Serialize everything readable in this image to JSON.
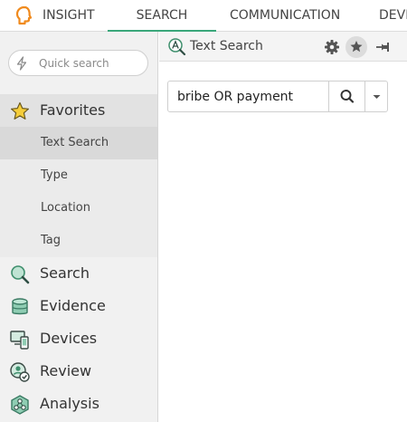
{
  "topnav": {
    "tabs": [
      {
        "label": "INSIGHT",
        "icon": "insight-head-icon"
      },
      {
        "label": "SEARCH",
        "active": true
      },
      {
        "label": "COMMUNICATION"
      },
      {
        "label": "DEVI"
      }
    ],
    "accent_color": "#3aa77a",
    "logo_color": "#f08a1d"
  },
  "sidebar": {
    "quick_search": {
      "placeholder": "Quick search",
      "value": "",
      "icon": "bolt-icon"
    },
    "favorites": {
      "label": "Favorites",
      "icon": "star-icon",
      "items": [
        {
          "label": "Text Search",
          "active": true
        },
        {
          "label": "Type"
        },
        {
          "label": "Location"
        },
        {
          "label": "Tag"
        }
      ]
    },
    "sections": [
      {
        "label": "Search",
        "icon": "magnifier-icon"
      },
      {
        "label": "Evidence",
        "icon": "database-icon"
      },
      {
        "label": "Devices",
        "icon": "devices-icon"
      },
      {
        "label": "Review",
        "icon": "review-icon"
      },
      {
        "label": "Analysis",
        "icon": "analysis-icon"
      }
    ]
  },
  "panel": {
    "title": "Text Search",
    "title_icon": "text-search-icon",
    "header_buttons": [
      "gear-icon",
      "star-icon",
      "pin-icon"
    ],
    "search": {
      "value": "bribe OR payment",
      "button_icon": "search-icon",
      "dropdown_icon": "caret-down-icon"
    }
  }
}
